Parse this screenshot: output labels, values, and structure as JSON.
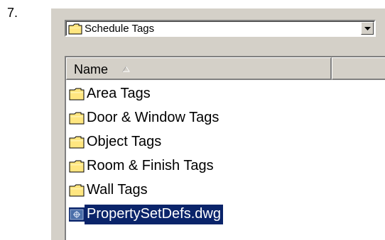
{
  "step": {
    "number": "7."
  },
  "location": {
    "current_folder": "Schedule Tags"
  },
  "listview": {
    "columns": [
      {
        "label": "Name",
        "sort": "ascending"
      },
      {
        "label": ""
      }
    ],
    "items": [
      {
        "label": "Area Tags",
        "type": "folder",
        "icon": "folder-icon"
      },
      {
        "label": "Door & Window Tags",
        "type": "folder",
        "icon": "folder-icon"
      },
      {
        "label": "Object Tags",
        "type": "folder",
        "icon": "folder-icon"
      },
      {
        "label": "Room & Finish Tags",
        "type": "folder",
        "icon": "folder-icon"
      },
      {
        "label": "Wall Tags",
        "type": "folder",
        "icon": "folder-icon"
      },
      {
        "label": "PropertySetDefs.dwg",
        "type": "file",
        "icon": "dwg-file-icon",
        "selected": true
      }
    ]
  },
  "colors": {
    "folder_yellow": "#ffe680",
    "selection": "#0a246a",
    "dialog_face": "#d4d0c8"
  }
}
